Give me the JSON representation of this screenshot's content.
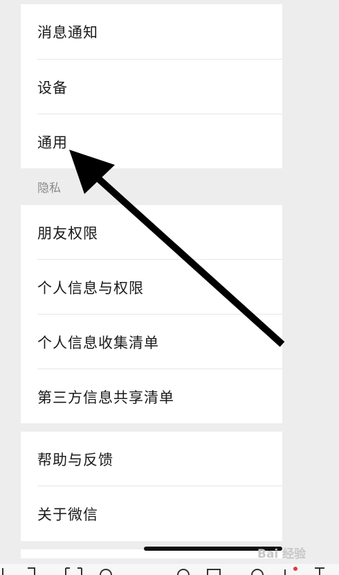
{
  "settings": {
    "top_items": [
      {
        "label": "消息通知"
      },
      {
        "label": "设备"
      },
      {
        "label": "通用"
      }
    ],
    "privacy_header": "隐私",
    "privacy_items": [
      {
        "label": "朋友权限"
      },
      {
        "label": "个人信息与权限"
      },
      {
        "label": "个人信息收集清单"
      },
      {
        "label": "第三方信息共享清单"
      }
    ],
    "about_items": [
      {
        "label": "帮助与反馈"
      },
      {
        "label": "关于微信"
      }
    ]
  },
  "overlay": {
    "annotation": "arrow-pointing-to-general",
    "watermark_text": "Bai 经验"
  },
  "colors": {
    "background": "#ededed",
    "row_background": "#ffffff",
    "text": "#1a1a1a",
    "section_header_text": "#8a8a8a",
    "arrow": "#000000"
  }
}
